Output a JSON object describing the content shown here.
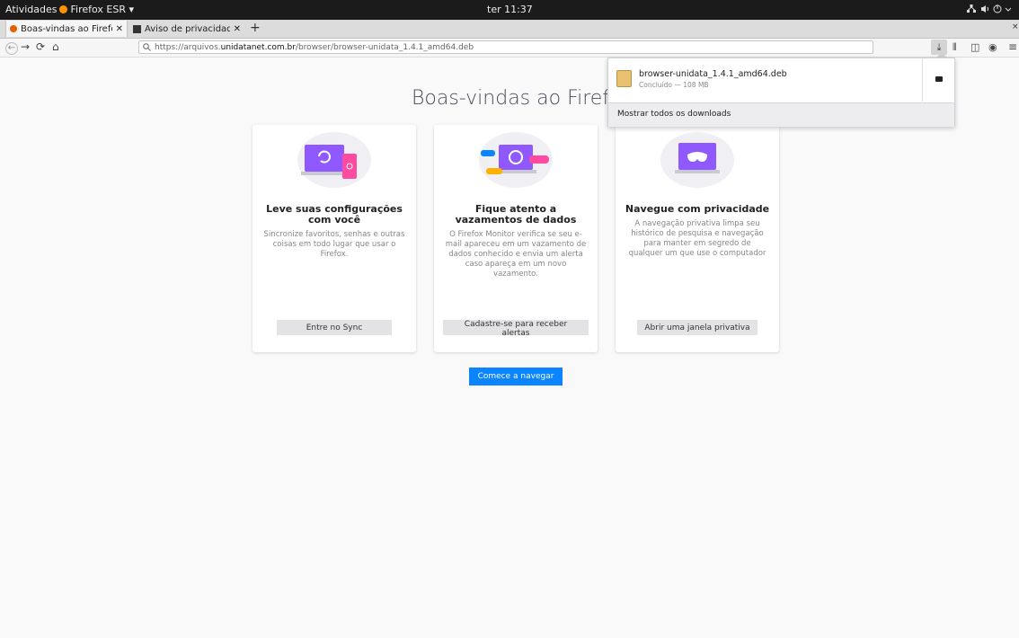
{
  "topbar": {
    "activities": "Atividades",
    "app_name": "Firefox ESR",
    "app_caret": "▾",
    "clock": "ter 11:37"
  },
  "tabs": [
    {
      "title": "Boas-vindas ao Firefox",
      "close": "✕"
    },
    {
      "title": "Aviso de privacidade do",
      "close": "✕"
    }
  ],
  "new_tab": "+",
  "navbar": {
    "url_prefix": "https://arquivos.",
    "url_domain": "unidatanet.com.br",
    "url_path": "/browser/browser-unidata_1.4.1_amd64.deb"
  },
  "page": {
    "heading": "Boas-vindas ao Firefox",
    "cards": [
      {
        "title": "Leve suas configurações com você",
        "text": "Sincronize favoritos, senhas e outras coisas em todo lugar que usar o Firefox.",
        "button": "Entre no Sync"
      },
      {
        "title": "Fique atento a vazamentos de dados",
        "text": "O Firefox Monitor verifica se seu e-mail apareceu em um vazamento de dados conhecido e envia um alerta caso apareça em um novo vazamento.",
        "button": "Cadastre-se para receber alertas"
      },
      {
        "title": "Navegue com privacidade",
        "text": "A navegação privativa limpa seu histórico de pesquisa e navegação para manter em segredo de qualquer um que use o computador",
        "button": "Abrir uma janela privativa"
      }
    ],
    "start_button": "Comece a navegar"
  },
  "downloads": {
    "filename": "browser-unidata_1.4.1_amd64.deb",
    "status": "Concluído — 108 MB",
    "show_all": "Mostrar todos os downloads"
  },
  "colors": {
    "accent": "#0a84ff",
    "purple": "#9059ff",
    "pink": "#ff4aa2",
    "topbar": "#1b1b1b"
  }
}
